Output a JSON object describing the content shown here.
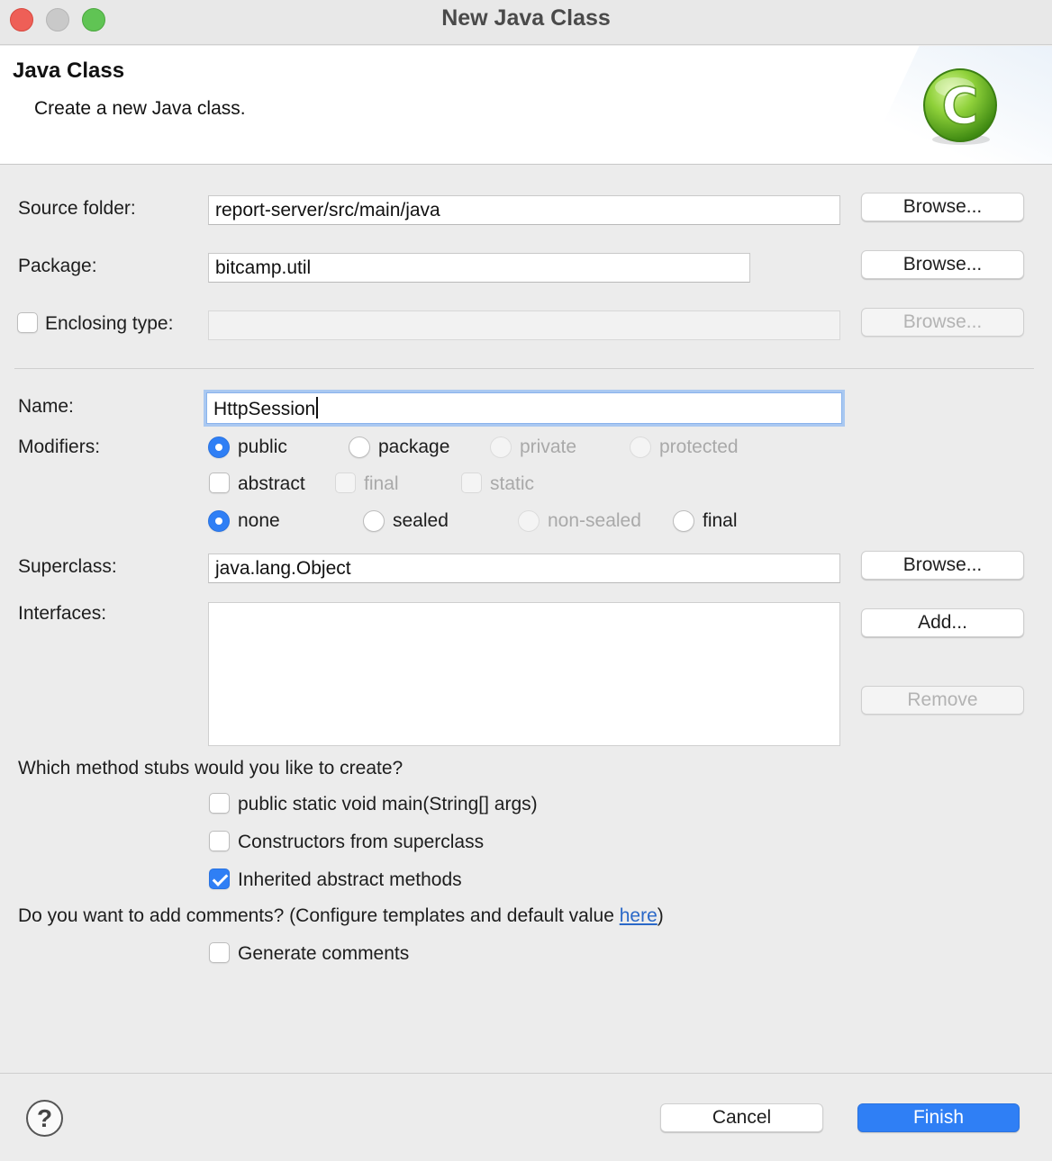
{
  "window": {
    "title": "New Java Class",
    "controls": [
      "close",
      "minimize",
      "maximize"
    ]
  },
  "header": {
    "title": "Java Class",
    "description": "Create a new Java class.",
    "icon": "java-class-icon"
  },
  "form": {
    "source_folder": {
      "label": "Source folder:",
      "value": "report-server/src/main/java",
      "browse": "Browse..."
    },
    "package": {
      "label": "Package:",
      "value": "bitcamp.util",
      "browse": "Browse..."
    },
    "enclosing_type": {
      "label": "Enclosing type:",
      "checked": false,
      "value": "",
      "browse": "Browse...",
      "enabled": false
    },
    "name": {
      "label": "Name:",
      "value": "HttpSession"
    },
    "modifiers": {
      "label": "Modifiers:",
      "access": [
        {
          "label": "public",
          "selected": true,
          "enabled": true
        },
        {
          "label": "package",
          "selected": false,
          "enabled": true
        },
        {
          "label": "private",
          "selected": false,
          "enabled": false
        },
        {
          "label": "protected",
          "selected": false,
          "enabled": false
        }
      ],
      "flags": [
        {
          "label": "abstract",
          "checked": false,
          "enabled": true
        },
        {
          "label": "final",
          "checked": false,
          "enabled": false
        },
        {
          "label": "static",
          "checked": false,
          "enabled": false
        }
      ],
      "sealing": [
        {
          "label": "none",
          "selected": true,
          "enabled": true
        },
        {
          "label": "sealed",
          "selected": false,
          "enabled": true
        },
        {
          "label": "non-sealed",
          "selected": false,
          "enabled": false
        },
        {
          "label": "final",
          "selected": false,
          "enabled": true
        }
      ]
    },
    "superclass": {
      "label": "Superclass:",
      "value": "java.lang.Object",
      "browse": "Browse..."
    },
    "interfaces": {
      "label": "Interfaces:",
      "items": [],
      "add": "Add...",
      "remove": "Remove"
    },
    "stubs": {
      "question": "Which method stubs would you like to create?",
      "options": [
        {
          "label": "public static void main(String[] args)",
          "checked": false
        },
        {
          "label": "Constructors from superclass",
          "checked": false
        },
        {
          "label": "Inherited abstract methods",
          "checked": true
        }
      ]
    },
    "comments": {
      "question_prefix": "Do you want to add comments? (Configure templates and default value ",
      "link": "here",
      "question_suffix": ")",
      "generate_label": "Generate comments",
      "generate_checked": false
    }
  },
  "footer": {
    "help_symbol": "?",
    "cancel": "Cancel",
    "finish": "Finish"
  },
  "colors": {
    "accent": "#2f7ff5",
    "link": "#2a68c8",
    "focus_ring": "#a9c8f1",
    "close": "#ee5f57",
    "minimize": "#c9c9c9",
    "maximize": "#60c454"
  }
}
